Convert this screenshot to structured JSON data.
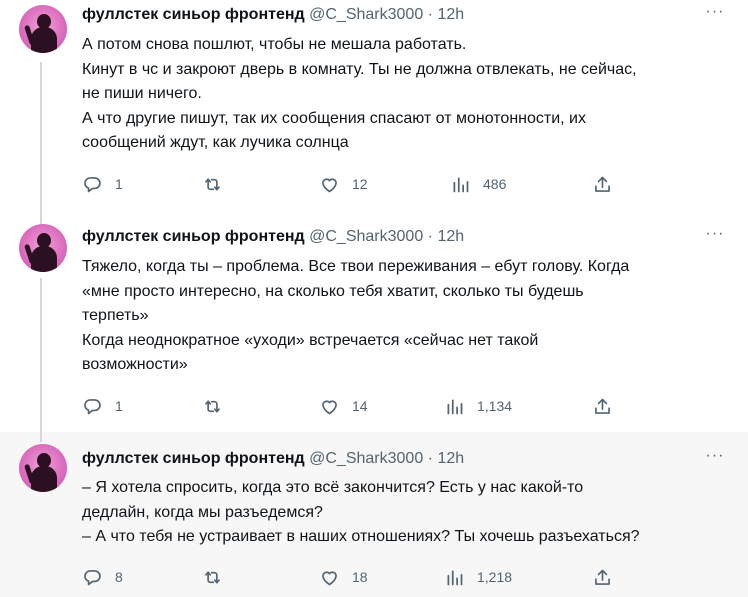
{
  "tweets": [
    {
      "name": "фуллстек синьор фронтенд",
      "handle": "@C_Shark3000",
      "separator": "·",
      "time": "12h",
      "more": "···",
      "lines": [
        "А потом снова пошлют, чтобы не мешала работать.",
        "Кинут в чс и закроют дверь в комнату. Ты не должна отвлекать, не сейчас,",
        "не пиши ничего.",
        "А что другие пишут, так их сообщения спасают от монотонности, их",
        "сообщений ждут, как лучика солнца"
      ],
      "replies": "1",
      "retweets": "",
      "likes": "12",
      "views": "486"
    },
    {
      "name": "фуллстек синьор фронтенд",
      "handle": "@C_Shark3000",
      "separator": "·",
      "time": "12h",
      "more": "···",
      "lines": [
        "Тяжело, когда ты – проблема. Все твои переживания – ебут голову. Когда",
        "«мне просто интересно, на сколько тебя хватит, сколько ты будешь",
        "терпеть»",
        "Когда неоднократное «уходи» встречается «сейчас нет такой",
        "возможности»"
      ],
      "replies": "1",
      "retweets": "",
      "likes": "14",
      "views": "1,134"
    },
    {
      "name": "фуллстек синьор фронтенд",
      "handle": "@C_Shark3000",
      "separator": "·",
      "time": "12h",
      "more": "···",
      "lines": [
        "– Я хотела спросить, когда это всё закончится? Есть у нас какой-то",
        "дедлайн, когда мы разъедемся?",
        "– А что тебя не устраивает в наших отношениях? Ты хочешь разъехаться?"
      ],
      "replies": "8",
      "retweets": "",
      "likes": "18",
      "views": "1,218"
    }
  ],
  "icons": {
    "reply": "reply-icon",
    "retweet": "retweet-icon",
    "like": "like-icon",
    "views": "views-icon",
    "share": "share-icon"
  },
  "colors": {
    "text": "#0f1419",
    "secondary": "#536471",
    "thread_line": "#cfd9de",
    "highlight_bg": "#f7f7f7"
  }
}
